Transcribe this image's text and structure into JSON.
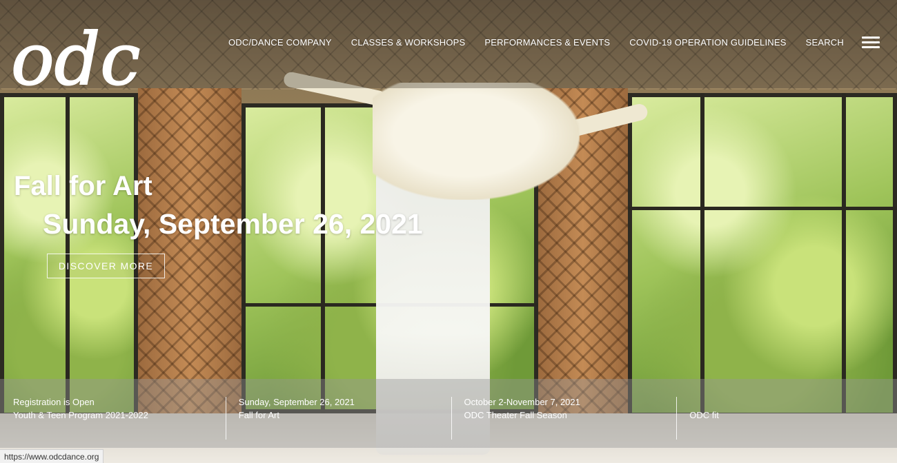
{
  "brand": {
    "logo_text": "odc"
  },
  "nav": {
    "items": [
      {
        "label": "ODC/DANCE COMPANY"
      },
      {
        "label": "CLASSES & WORKSHOPS"
      },
      {
        "label": "PERFORMANCES & EVENTS"
      },
      {
        "label": "COVID-19 OPERATION GUIDELINES"
      },
      {
        "label": "SEARCH"
      }
    ],
    "menu_icon": "hamburger-menu-icon"
  },
  "hero": {
    "title": "Fall for Art",
    "subtitle": "Sunday, September 26, 2021",
    "button_label": "DISCOVER MORE"
  },
  "events": [
    {
      "line1": "Registration is Open",
      "line2": "Youth & Teen Program 2021-2022"
    },
    {
      "line1": "Sunday, September 26, 2021",
      "line2": "Fall for Art"
    },
    {
      "line1": "October 2-November 7, 2021",
      "line2": "ODC Theater Fall Season"
    },
    {
      "line1": "",
      "line2": "ODC fit"
    }
  ],
  "status_bar": {
    "url": "https://www.odcdance.org"
  }
}
